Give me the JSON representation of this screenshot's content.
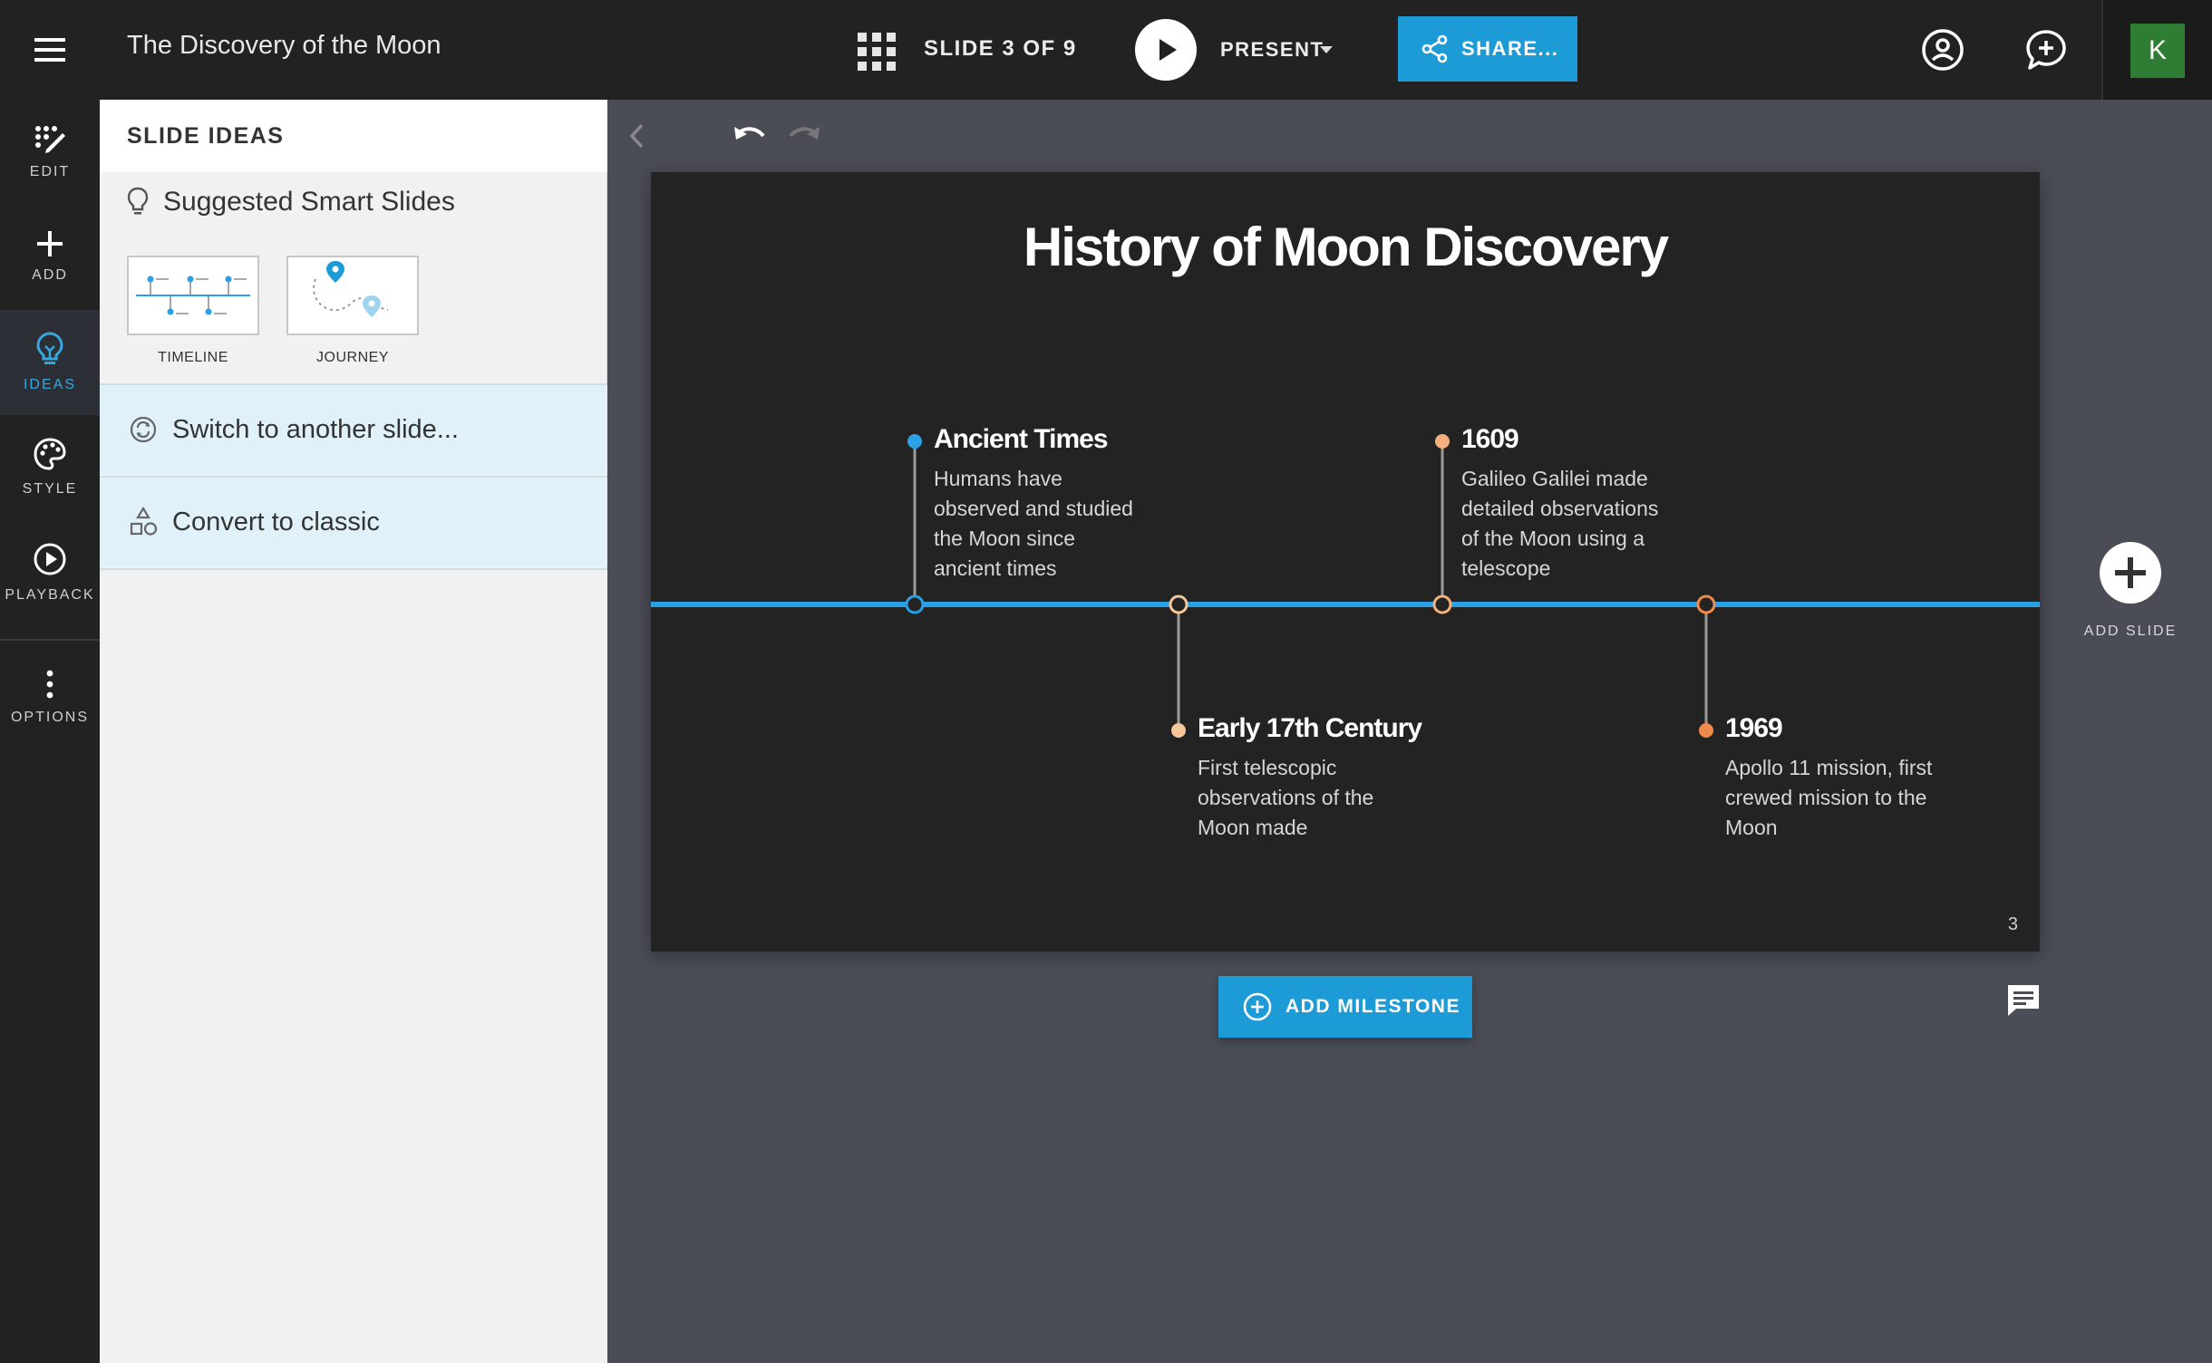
{
  "app": {
    "doc_title": "The Discovery of the Moon",
    "slide_counter": "SLIDE 3 OF 9",
    "present_label": "PRESENT",
    "share_label": "SHARE...",
    "avatar_initial": "K"
  },
  "rail": {
    "items": [
      {
        "label": "EDIT",
        "icon": "edit-icon"
      },
      {
        "label": "ADD",
        "icon": "plus-icon"
      },
      {
        "label": "IDEAS",
        "icon": "lightbulb-icon",
        "active": true
      },
      {
        "label": "STYLE",
        "icon": "palette-icon"
      },
      {
        "label": "PLAYBACK",
        "icon": "play-circle-icon"
      },
      {
        "label": "OPTIONS",
        "icon": "kebab-icon"
      }
    ]
  },
  "panel": {
    "title": "SLIDE IDEAS",
    "suggested_heading": "Suggested Smart Slides",
    "thumbnails": [
      {
        "label": "TIMELINE",
        "icon": "timeline-thumbnail"
      },
      {
        "label": "JOURNEY",
        "icon": "journey-thumbnail"
      }
    ],
    "options": [
      {
        "label": "Switch to another slide...",
        "icon": "swap-icon"
      },
      {
        "label": "Convert to classic",
        "icon": "shapes-icon"
      }
    ]
  },
  "slide": {
    "title": "History of Moon Discovery",
    "number": "3",
    "milestones": [
      {
        "title": "Ancient Times",
        "desc": "Humans have observed and studied the Moon since ancient times",
        "color": "#2aa0e6"
      },
      {
        "title": "Early 17th Century",
        "desc": "First telescopic observations of the Moon made",
        "color": "#f6c79a"
      },
      {
        "title": "1609",
        "desc": "Galileo Galilei made detailed observations of the Moon using a telescope",
        "color": "#f4b07c"
      },
      {
        "title": "1969",
        "desc": "Apollo 11 mission, first crewed mission to the Moon",
        "color": "#f08a4b"
      }
    ],
    "line_color": "#2aa0e6"
  },
  "actions": {
    "add_milestone": "ADD MILESTONE",
    "add_slide": "ADD SLIDE"
  },
  "colors": {
    "accent": "#1d9bd7",
    "topbar": "#222222",
    "canvas_bg": "#4a4d56"
  }
}
